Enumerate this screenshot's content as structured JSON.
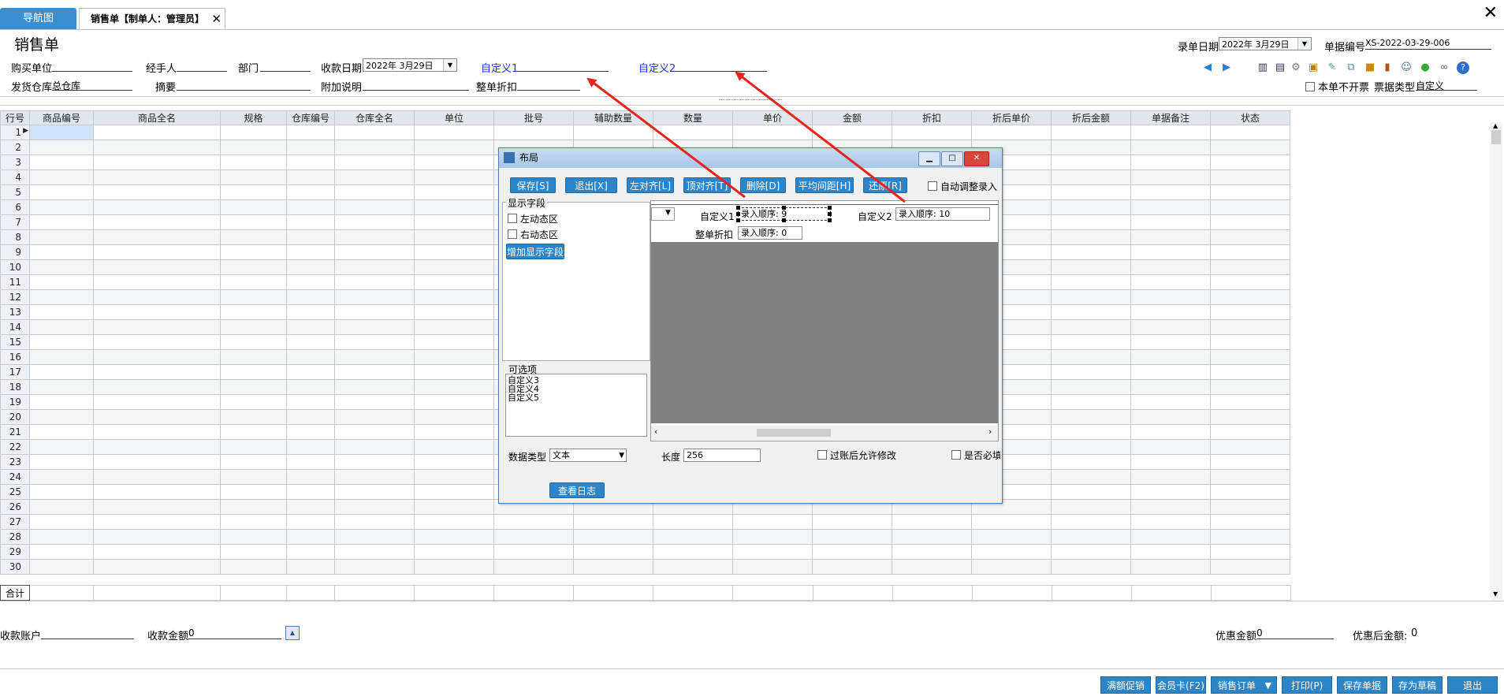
{
  "tabs": {
    "nav": "导航图",
    "sale": "销售单【制单人：管理员】",
    "close": "✕"
  },
  "window": {
    "close": "✕"
  },
  "page": {
    "title": "销售单"
  },
  "header": {
    "buyer_label": "购买单位",
    "buyer_value": "",
    "handler_label": "经手人",
    "handler_value": "",
    "dept_label": "部门",
    "dept_value": "",
    "pay_date_label": "收款日期",
    "pay_date_value": "2022年 3月29日",
    "custom1_label": "自定义1",
    "custom1_value": "",
    "custom2_label": "自定义2",
    "custom2_value": "",
    "warehouse_label": "发货仓库",
    "warehouse_value": "总仓库",
    "summary_label": "摘要",
    "summary_value": "",
    "note_label": "附加说明",
    "note_value": "",
    "discount_label": "整单折扣",
    "discount_value": "",
    "entry_date_label": "录单日期",
    "entry_date_value": "2022年 3月29日",
    "doc_no_label": "单据编号",
    "doc_no_value": "XS-2022-03-29-006",
    "no_invoice_label": "本单不开票",
    "ticket_type_label": "票据类型",
    "ticket_type_value": "自定义"
  },
  "toolbar_icons": [
    "arrow-left-icon",
    "arrow-right-icon",
    "chart-icon",
    "printer-icon",
    "gear-icon",
    "box-add-icon",
    "edit-icon",
    "export-icon",
    "package-icon",
    "door-icon",
    "user-icon",
    "leaf-icon",
    "link-icon",
    "help-icon"
  ],
  "grid": {
    "columns": [
      "行号",
      "商品编号",
      "商品全名",
      "规格",
      "仓库编号",
      "仓库全名",
      "单位",
      "批号",
      "辅助数量",
      "数量",
      "单价",
      "金额",
      "折扣",
      "折后单价",
      "折后金额",
      "单据备注",
      "状态"
    ],
    "rows": [
      "1",
      "2",
      "3",
      "4",
      "5",
      "6",
      "7",
      "8",
      "9",
      "10",
      "11",
      "12",
      "13",
      "14",
      "15",
      "16",
      "17",
      "18",
      "19",
      "20",
      "21",
      "22",
      "23",
      "24",
      "25",
      "26",
      "27",
      "28",
      "29",
      "30"
    ],
    "total_label": "合计"
  },
  "dialog": {
    "title": "布局",
    "buttons": {
      "save": "保存[S]",
      "exit": "退出[X]",
      "left_align": "左对齐[L]",
      "top_align": "顶对齐[T]",
      "delete": "删除[D]",
      "even_spacing": "平均间距[H]",
      "restore": "还原[R]"
    },
    "auto_adjust_label": "自动调整录入",
    "display_fields_title": "显示字段",
    "left_dynamic_label": "左动态区",
    "right_dynamic_label": "右动态区",
    "add_field_button": "增加显示字段",
    "optional_title": "可选项",
    "optional_items": [
      "自定义3",
      "自定义4",
      "自定义5"
    ],
    "canvas": {
      "custom1_label": "自定义1",
      "custom1_order": "录入顺序: 9",
      "custom2_label": "自定义2",
      "custom2_order": "录入顺序: 10",
      "discount_label": "整单折扣",
      "discount_order": "录入顺序: 0"
    },
    "data_type_label": "数据类型",
    "data_type_value": "文本",
    "length_label": "长度",
    "length_value": "256",
    "allow_edit_label": "过账后允许修改",
    "required_label": "是否必填",
    "view_log_button": "查看日志"
  },
  "footer": {
    "account_label": "收款账户",
    "account_value": "",
    "amount_label": "收款金额",
    "amount_value": "0",
    "discount_amount_label": "优惠金额",
    "discount_amount_value": "0",
    "after_discount_label": "优惠后金额:",
    "after_discount_value": "0"
  },
  "actions": {
    "promo": "满额促销",
    "member": "会员卡(F2)",
    "sales_order": "销售订单",
    "print": "打印(P)",
    "save": "保存单据",
    "draft": "存为草稿",
    "exit": "退出"
  },
  "colors": {
    "accent": "#2d84c6",
    "arrow": "#e8231a",
    "custom_label": "#1a36d8"
  }
}
